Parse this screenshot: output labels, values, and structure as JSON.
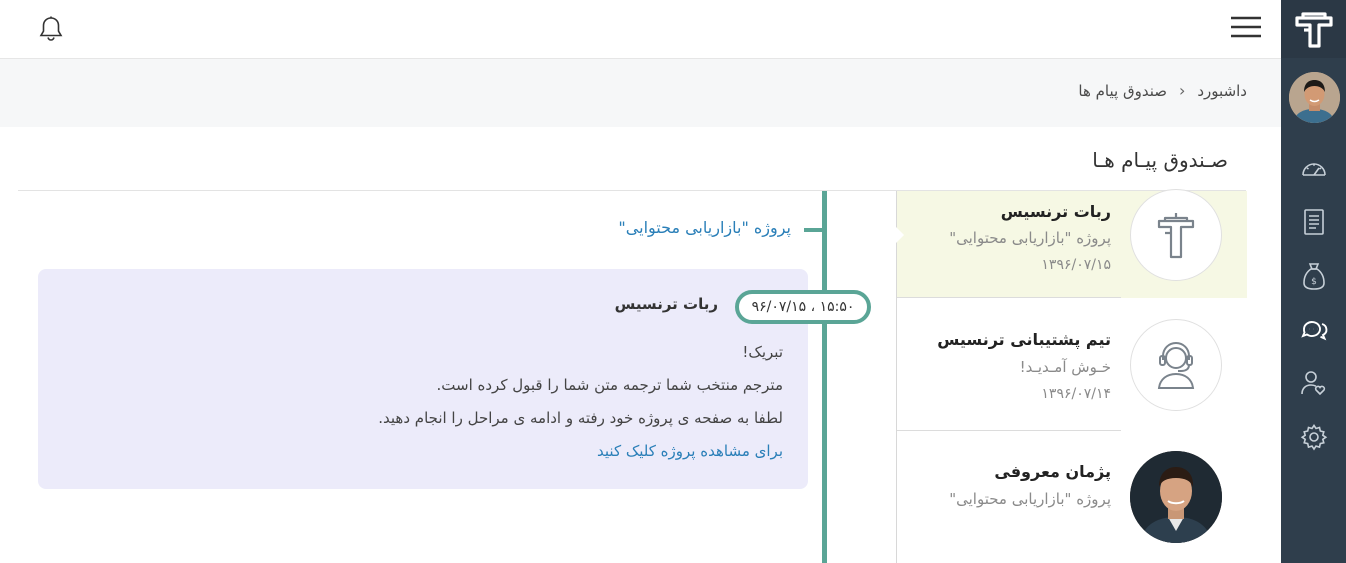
{
  "topbar": {
    "bell_icon": "bell-icon",
    "menu_icon": "hamburger-menu-icon"
  },
  "sidebar": {
    "logo_icon": "tarjomic-logo-icon",
    "items": [
      {
        "icon": "dashboard-speedometer-icon"
      },
      {
        "icon": "document-list-icon"
      },
      {
        "icon": "money-bag-icon"
      },
      {
        "icon": "chat-bubbles-icon"
      },
      {
        "icon": "user-heart-icon"
      },
      {
        "icon": "settings-gear-icon"
      }
    ]
  },
  "breadcrumb": {
    "home": "داشبورد",
    "separator": "‹",
    "current": "صندوق پیام ها"
  },
  "page_title": "صـندوق پیـام هـا",
  "conversations": [
    {
      "name": "ربات ترنسیس",
      "subtitle": "پروژه \"بازاریابی محتوایی\"",
      "date": "۱۳۹۶/۰۷/۱۵",
      "avatar": "robot-logo-icon",
      "active": true
    },
    {
      "name": "تیم پشتیبانی ترنسیس",
      "subtitle": "خـوش آمـدیـد!",
      "date": "۱۳۹۶/۰۷/۱۴",
      "avatar": "support-headset-icon",
      "active": false
    },
    {
      "name": "پژمان معروفی",
      "subtitle": "پروژه \"بازاریابی محتوایی\"",
      "date": "",
      "avatar": "user-photo",
      "active": false
    }
  ],
  "thread": {
    "project_link": "پروژه \"بازاریابی محتوایی\"",
    "timestamp": "۱۵:۵۰ ، ۹۶/۰۷/۱۵",
    "sender": "ربات ترنسیس",
    "lines": [
      "تبریک!",
      "مترجم منتخب شما ترجمه متن شما را قبول کرده است.",
      "لطفا به صفحه ی پروژه خود رفته و ادامه ی مراحل را انجام دهید."
    ],
    "cta": "برای مشاهده پروژه کلیک کنید"
  },
  "colors": {
    "sidebar": "#2f3e4c",
    "accent": "#5aa596",
    "link": "#2a7fb8",
    "active_conversation": "#f6f8e4",
    "message_bg": "#ecebfa"
  }
}
